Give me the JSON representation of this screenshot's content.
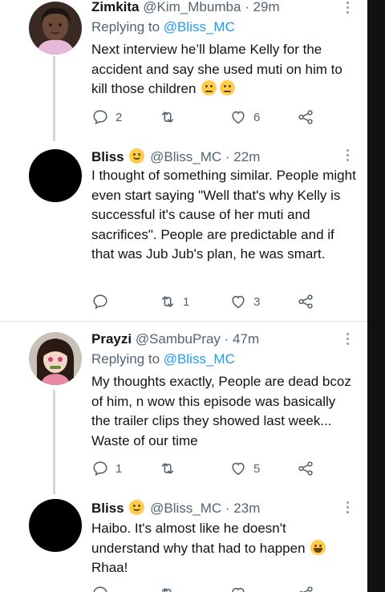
{
  "tweets": [
    {
      "name": "Zimkita",
      "handle": "@Kim_Mbumba",
      "time": "29m",
      "replying_prefix": "Replying to",
      "replying_to": "@Bliss_MC",
      "text": "Next interview he’ll blame Kelly for the accident and say she used muti on him to kill those children",
      "text_emoji": "rolling-eyes-emoji x2",
      "reply_count": "2",
      "retweet_count": "",
      "like_count": "6"
    },
    {
      "name": "Bliss",
      "name_emoji": "smiling-face-emoji",
      "handle": "@Bliss_MC",
      "time": "22m",
      "text": "I thought of something similar. People might even start saying \"Well that's why Kelly is successful it's cause of her muti and sacrifices\". People are predictable and if that was Jub Jub's plan, he was smart.",
      "reply_count": "",
      "retweet_count": "1",
      "like_count": "3"
    },
    {
      "name": "Prayzi",
      "handle": "@SambuPray",
      "time": "47m",
      "replying_prefix": "Replying to",
      "replying_to": "@Bliss_MC",
      "text": "My thoughts exactly, People are dead bcoz of him, n wow this episode was basically the trailer clips they showed last week... Waste of our time",
      "reply_count": "1",
      "retweet_count": "",
      "like_count": "5"
    },
    {
      "name": "Bliss",
      "name_emoji": "smiling-face-emoji",
      "handle": "@Bliss_MC",
      "time": "23m",
      "text_line1": "Haibo. It's almost like he doesn't",
      "text_line2": "understand why that had to happen",
      "text_line2_emoji": "laughing-tears-emoji",
      "text_line3": "Rhaa!"
    }
  ],
  "separator": "·",
  "colors": {
    "link": "#1d9bf0",
    "secondary": "#536471",
    "divider": "#e1e8ed",
    "thread_line": "#cfd9de"
  }
}
